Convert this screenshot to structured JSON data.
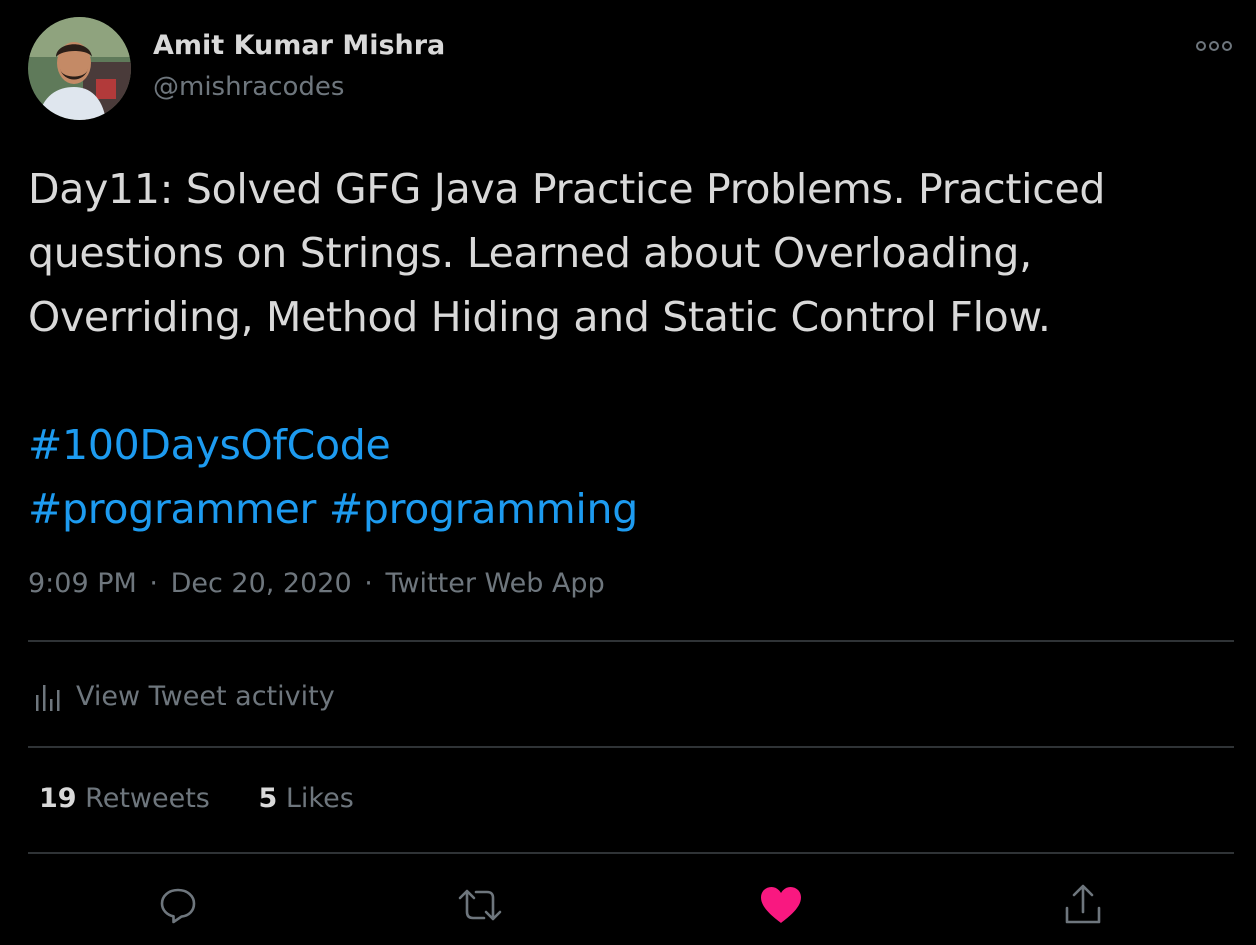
{
  "author": {
    "name": "Amit Kumar Mishra",
    "handle": "@mishracodes"
  },
  "tweet": {
    "lines": [
      "Day11: Solved GFG Java Practice Problems. Practiced",
      "questions on Strings. Learned about Overloading,",
      "Overriding, Method Hiding and Static Control Flow."
    ],
    "hashtags": [
      "#100DaysOfCode",
      "#programmer",
      "#programming"
    ]
  },
  "meta": {
    "time": "9:09 PM",
    "date": "Dec 20, 2020",
    "source": "Twitter Web App",
    "separator": "·"
  },
  "activity": {
    "label": "View Tweet activity"
  },
  "stats": {
    "retweets_count": "19",
    "retweets_label": "Retweets",
    "likes_count": "5",
    "likes_label": "Likes"
  },
  "actions": {
    "reply_icon": "reply-icon",
    "retweet_icon": "retweet-icon",
    "like_icon": "heart-icon",
    "liked": true,
    "share_icon": "share-icon"
  },
  "colors": {
    "background": "#000000",
    "text": "#d9d9d9",
    "secondary": "#6e767d",
    "link": "#1d9bf0",
    "like": "#f91880",
    "divider": "#2f3336"
  }
}
